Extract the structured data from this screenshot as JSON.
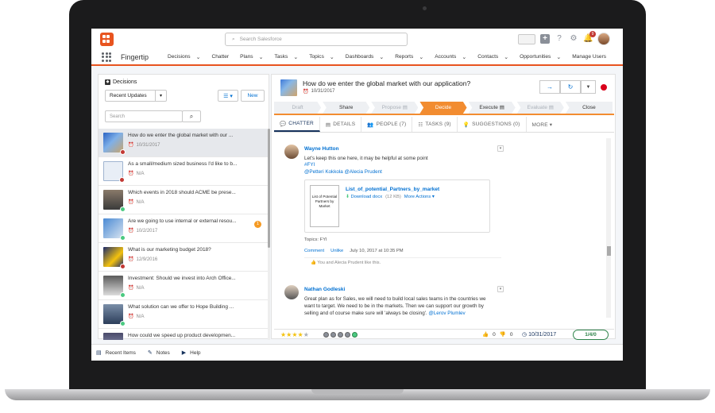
{
  "header": {
    "search_placeholder": "Search Salesforce",
    "notification_count": "9"
  },
  "nav": {
    "app_name": "Fingertip",
    "items": [
      {
        "label": "Decisions",
        "dropdown": true
      },
      {
        "label": "Chatter",
        "dropdown": false
      },
      {
        "label": "Plans",
        "dropdown": true
      },
      {
        "label": "Tasks",
        "dropdown": true
      },
      {
        "label": "Topics",
        "dropdown": true
      },
      {
        "label": "Dashboards",
        "dropdown": true
      },
      {
        "label": "Reports",
        "dropdown": true
      },
      {
        "label": "Accounts",
        "dropdown": true
      },
      {
        "label": "Contacts",
        "dropdown": true
      },
      {
        "label": "Opportunities",
        "dropdown": true
      },
      {
        "label": "Manage Users",
        "dropdown": false
      }
    ],
    "accent": "#e8541f"
  },
  "left": {
    "title": "Decisions",
    "list_view": "Recent Updates",
    "new_label": "New",
    "search_placeholder": "Search",
    "items": [
      {
        "title": "How do we enter the global market with our ...",
        "date": "10/31/2017",
        "thumb": "globe",
        "status": "#c23934",
        "badge": ""
      },
      {
        "title": "As a small/medium sized business I'd like to b...",
        "date": "N/A",
        "thumb": "chat",
        "status": "#c23934",
        "badge": ""
      },
      {
        "title": "Which events in 2018 should ACME be prese...",
        "date": "N/A",
        "thumb": "people",
        "status": "#4bca81",
        "badge": ""
      },
      {
        "title": "Are we going to use internal or external resou...",
        "date": "10/2/2017",
        "thumb": "team",
        "status": "#4bca81",
        "badge": "1"
      },
      {
        "title": "What is our marketing budget 2018?",
        "date": "12/9/2016",
        "thumb": "stars",
        "status": "#c23934",
        "badge": ""
      },
      {
        "title": "Investment: Should we invest into Arch Office...",
        "date": "N/A",
        "thumb": "house",
        "status": "#4bca81",
        "badge": ""
      },
      {
        "title": "What solution can we offer to Hope Building ...",
        "date": "N/A",
        "thumb": "building",
        "status": "#4bca81",
        "badge": ""
      },
      {
        "title": "How could we speed up product developmen...",
        "date": "",
        "thumb": "product",
        "status": "#4bca81",
        "badge": ""
      }
    ]
  },
  "record": {
    "title": "How do we enter the global market with our application?",
    "date": "10/31/2017",
    "path": [
      {
        "label": "Draft",
        "state": "todo"
      },
      {
        "label": "Share",
        "state": "done"
      },
      {
        "label": "Propose ▤",
        "state": "todo"
      },
      {
        "label": "Decide",
        "state": "current"
      },
      {
        "label": "Execute ▤",
        "state": "done"
      },
      {
        "label": "Evaluate ▤",
        "state": "todo"
      },
      {
        "label": "Close",
        "state": "last"
      }
    ],
    "tabs": [
      {
        "icon": "chat-icon",
        "glyph": "💬",
        "label": "CHATTER"
      },
      {
        "icon": "details-icon",
        "glyph": "▤",
        "label": "DETAILS"
      },
      {
        "icon": "people-icon",
        "glyph": "👥",
        "label": "PEOPLE (7)"
      },
      {
        "icon": "tasks-icon",
        "glyph": "☷",
        "label": "TASKS (9)"
      },
      {
        "icon": "suggestions-icon",
        "glyph": "💡",
        "label": "SUGGESTIONS (0)"
      },
      {
        "icon": "",
        "glyph": "",
        "label": "MORE ▾"
      }
    ]
  },
  "post1": {
    "author": "Wayne Hutton",
    "line1": "Let's keep this one here, it may be helpful at some point",
    "hashtag": "#FYI",
    "mentions": "@Petteri Kokkola @Alecia Prudent",
    "doc_thumb_text": "List of Potential Partners by Market",
    "attachment_name": "List_of_potential_Partners_by_market",
    "download": "Download docx",
    "size": "(12 KB)",
    "more_actions": "More Actions ▾",
    "topics": "Topics:  FYI",
    "comment": "Comment",
    "unlike": "Unlike",
    "timestamp": "July 10, 2017 at 10:35 PM",
    "likes": "You and Alecia Prudent like this."
  },
  "post2": {
    "author": "Nathan Godleski",
    "line1": "Great plan as for Sales, we will need to build local sales teams in the countries we",
    "line2": "want to target. We need to be in the markets. Then we can support our growth by",
    "line3": "selling and of course make sure will 'always be closing'.",
    "mention": "@Lerov Plumlev"
  },
  "footer_bar": {
    "upvotes": "0",
    "downvotes": "0",
    "date": "10/31/2017",
    "tally": "1/4/0",
    "rating": 4
  },
  "bottom_utility": [
    {
      "label": "Recent Items",
      "icon": "recent-items-icon"
    },
    {
      "label": "Notes",
      "icon": "notes-icon"
    },
    {
      "label": "Help",
      "icon": "help-icon"
    }
  ]
}
